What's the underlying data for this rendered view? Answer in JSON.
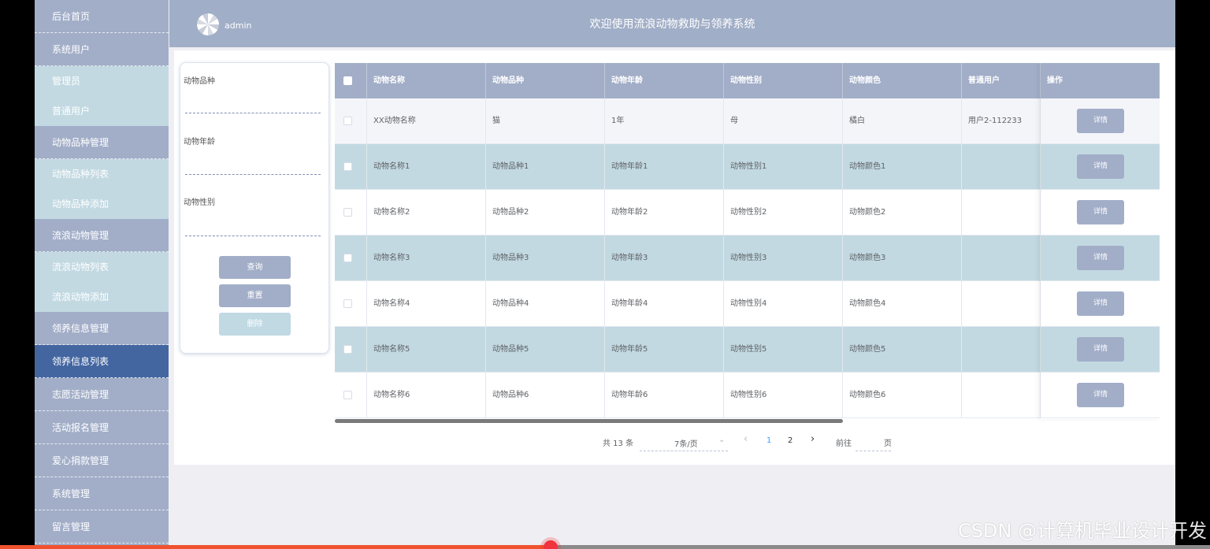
{
  "header": {
    "username": "admin",
    "title": "欢迎使用流浪动物救助与领养系统"
  },
  "sidebar": {
    "items": [
      {
        "label": "后台首页",
        "type": "top"
      },
      {
        "label": "系统用户",
        "type": "top"
      },
      {
        "label": "管理员",
        "type": "sub"
      },
      {
        "label": "普通用户",
        "type": "sub"
      },
      {
        "label": "动物品种管理",
        "type": "top"
      },
      {
        "label": "动物品种列表",
        "type": "sub"
      },
      {
        "label": "动物品种添加",
        "type": "sub"
      },
      {
        "label": "流浪动物管理",
        "type": "top"
      },
      {
        "label": "流浪动物列表",
        "type": "sub"
      },
      {
        "label": "流浪动物添加",
        "type": "sub"
      },
      {
        "label": "领养信息管理",
        "type": "top"
      },
      {
        "label": "领养信息列表",
        "type": "active"
      },
      {
        "label": "志愿活动管理",
        "type": "top"
      },
      {
        "label": "活动报名管理",
        "type": "top"
      },
      {
        "label": "爱心捐款管理",
        "type": "top"
      },
      {
        "label": "系统管理",
        "type": "top"
      },
      {
        "label": "留言管理",
        "type": "top"
      }
    ]
  },
  "search": {
    "breed_label": "动物品种",
    "age_label": "动物年龄",
    "gender_label": "动物性别",
    "query_button": "查询",
    "reset_button": "重置",
    "delete_button": "删除"
  },
  "table": {
    "columns": [
      "动物名称",
      "动物品种",
      "动物年龄",
      "动物性别",
      "动物颜色",
      "普通用户",
      "操作"
    ],
    "detail_label": "详情",
    "rows": [
      [
        "XX动物名称",
        "猫",
        "1年",
        "母",
        "橘白",
        "用户2-112233"
      ],
      [
        "动物名称1",
        "动物品种1",
        "动物年龄1",
        "动物性别1",
        "动物颜色1",
        ""
      ],
      [
        "动物名称2",
        "动物品种2",
        "动物年龄2",
        "动物性别2",
        "动物颜色2",
        ""
      ],
      [
        "动物名称3",
        "动物品种3",
        "动物年龄3",
        "动物性别3",
        "动物颜色3",
        ""
      ],
      [
        "动物名称4",
        "动物品种4",
        "动物年龄4",
        "动物性别4",
        "动物颜色4",
        ""
      ],
      [
        "动物名称5",
        "动物品种5",
        "动物年龄5",
        "动物性别5",
        "动物颜色5",
        ""
      ],
      [
        "动物名称6",
        "动物品种6",
        "动物年龄6",
        "动物性别6",
        "动物颜色6",
        ""
      ]
    ]
  },
  "pagination": {
    "total_text": "共 13 条",
    "page_size": "7条/页",
    "pages": [
      "1",
      "2"
    ],
    "current_page": "1",
    "goto_prefix": "前往",
    "goto_suffix": "页",
    "prev_icon": "‹",
    "next_icon": "›",
    "dropdown_icon": "⌄"
  },
  "watermark": "CSDN @计算机毕业设计开发",
  "colors": {
    "primary": "#a2aec8",
    "active_menu": "#4366a1",
    "sub_menu": "#c2d9e2",
    "row_highlight": "#c2d9e2",
    "pager_active": "#409eff",
    "video_progress": "#f0522f"
  },
  "video": {
    "progress": 0.455
  }
}
